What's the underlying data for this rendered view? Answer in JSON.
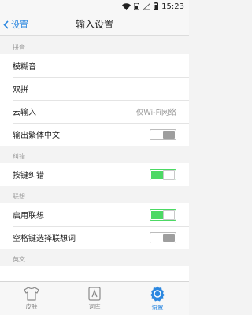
{
  "status_bar": {
    "time": "15:23"
  },
  "nav": {
    "back_label": "设置",
    "title": "输入设置"
  },
  "sections": [
    {
      "header": "拼音",
      "rows": [
        {
          "label": "模糊音"
        },
        {
          "label": "双拼"
        },
        {
          "label": "云输入",
          "value": "仅Wi-Fi网络"
        },
        {
          "label": "输出繁体中文",
          "toggle": "off"
        }
      ]
    },
    {
      "header": "纠错",
      "rows": [
        {
          "label": "按键纠错",
          "toggle": "on"
        }
      ]
    },
    {
      "header": "联想",
      "rows": [
        {
          "label": "启用联想",
          "toggle": "on"
        },
        {
          "label": "空格键选择联想词",
          "toggle": "off"
        }
      ]
    },
    {
      "header": "英文",
      "rows": []
    }
  ],
  "tabs": [
    {
      "label": "皮肤",
      "icon": "shirt-icon",
      "active": false
    },
    {
      "label": "词库",
      "icon": "dictionary-icon",
      "active": false
    },
    {
      "label": "设置",
      "icon": "gear-icon",
      "active": true
    }
  ],
  "colors": {
    "accent": "#2b87e0",
    "toggle_on": "#4cd964"
  }
}
